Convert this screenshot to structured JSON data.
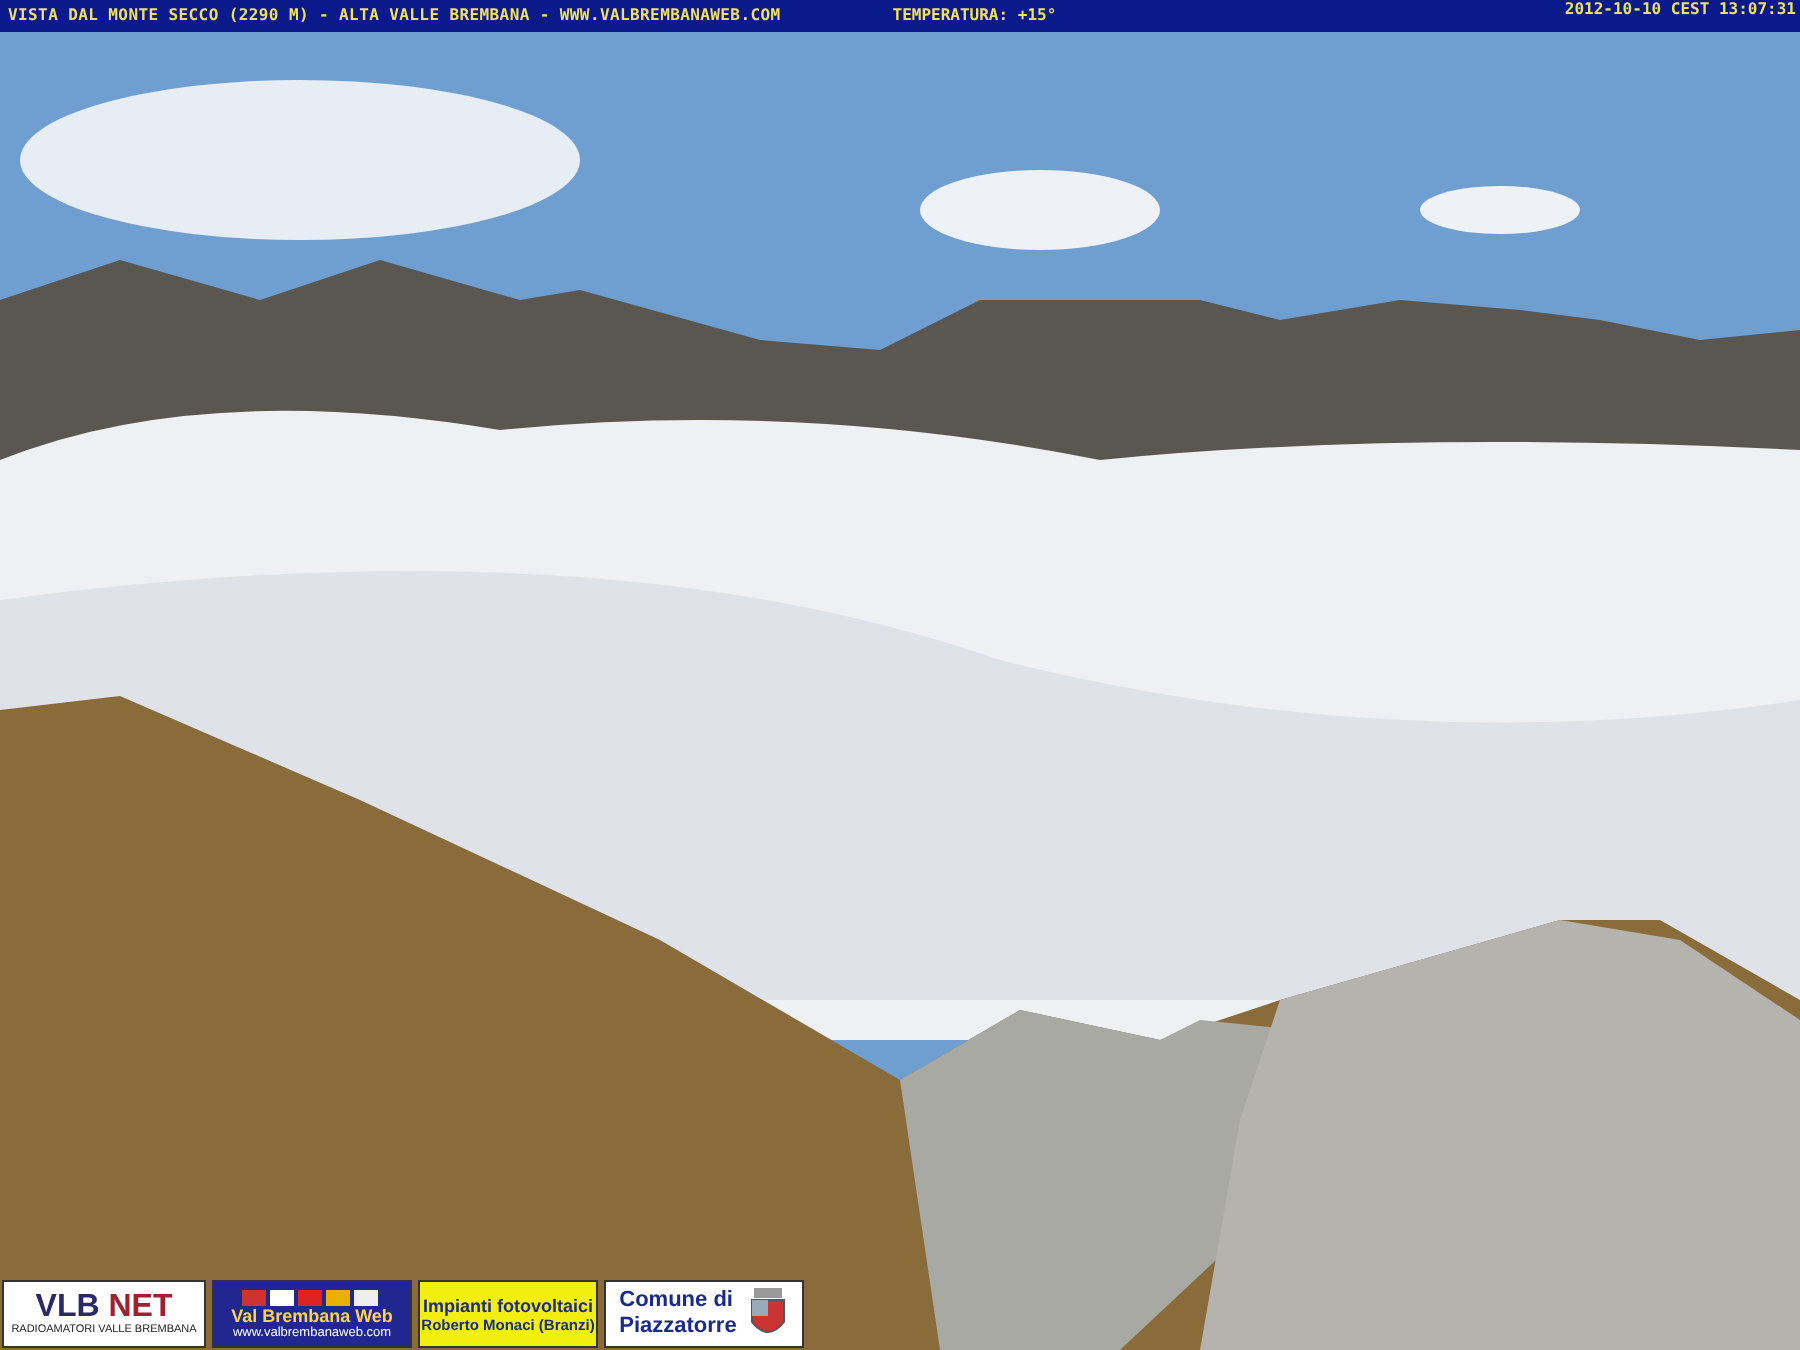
{
  "header": {
    "caption": "VISTA DAL MONTE SECCO (2290 M) - ALTA VALLE BREMBANA - WWW.VALBREMBANAWEB.COM",
    "temperature": "TEMPERATURA: +15°",
    "timestamp": "2012-10-10 CEST 13:07:31"
  },
  "logos": [
    {
      "kind": "vlbnet",
      "lines": [
        "VLB",
        "NET",
        "RADIOAMATORI VALLE BREMBANA"
      ]
    },
    {
      "kind": "web",
      "lines": [
        "Val Brembana Web",
        "www.valbrembanaweb.com"
      ]
    },
    {
      "kind": "solar",
      "lines": [
        "Impianti fotovoltaici",
        "Roberto Monaci (Branzi)"
      ]
    },
    {
      "kind": "comune",
      "lines": [
        "Comune di",
        "Piazzatorre"
      ]
    }
  ]
}
